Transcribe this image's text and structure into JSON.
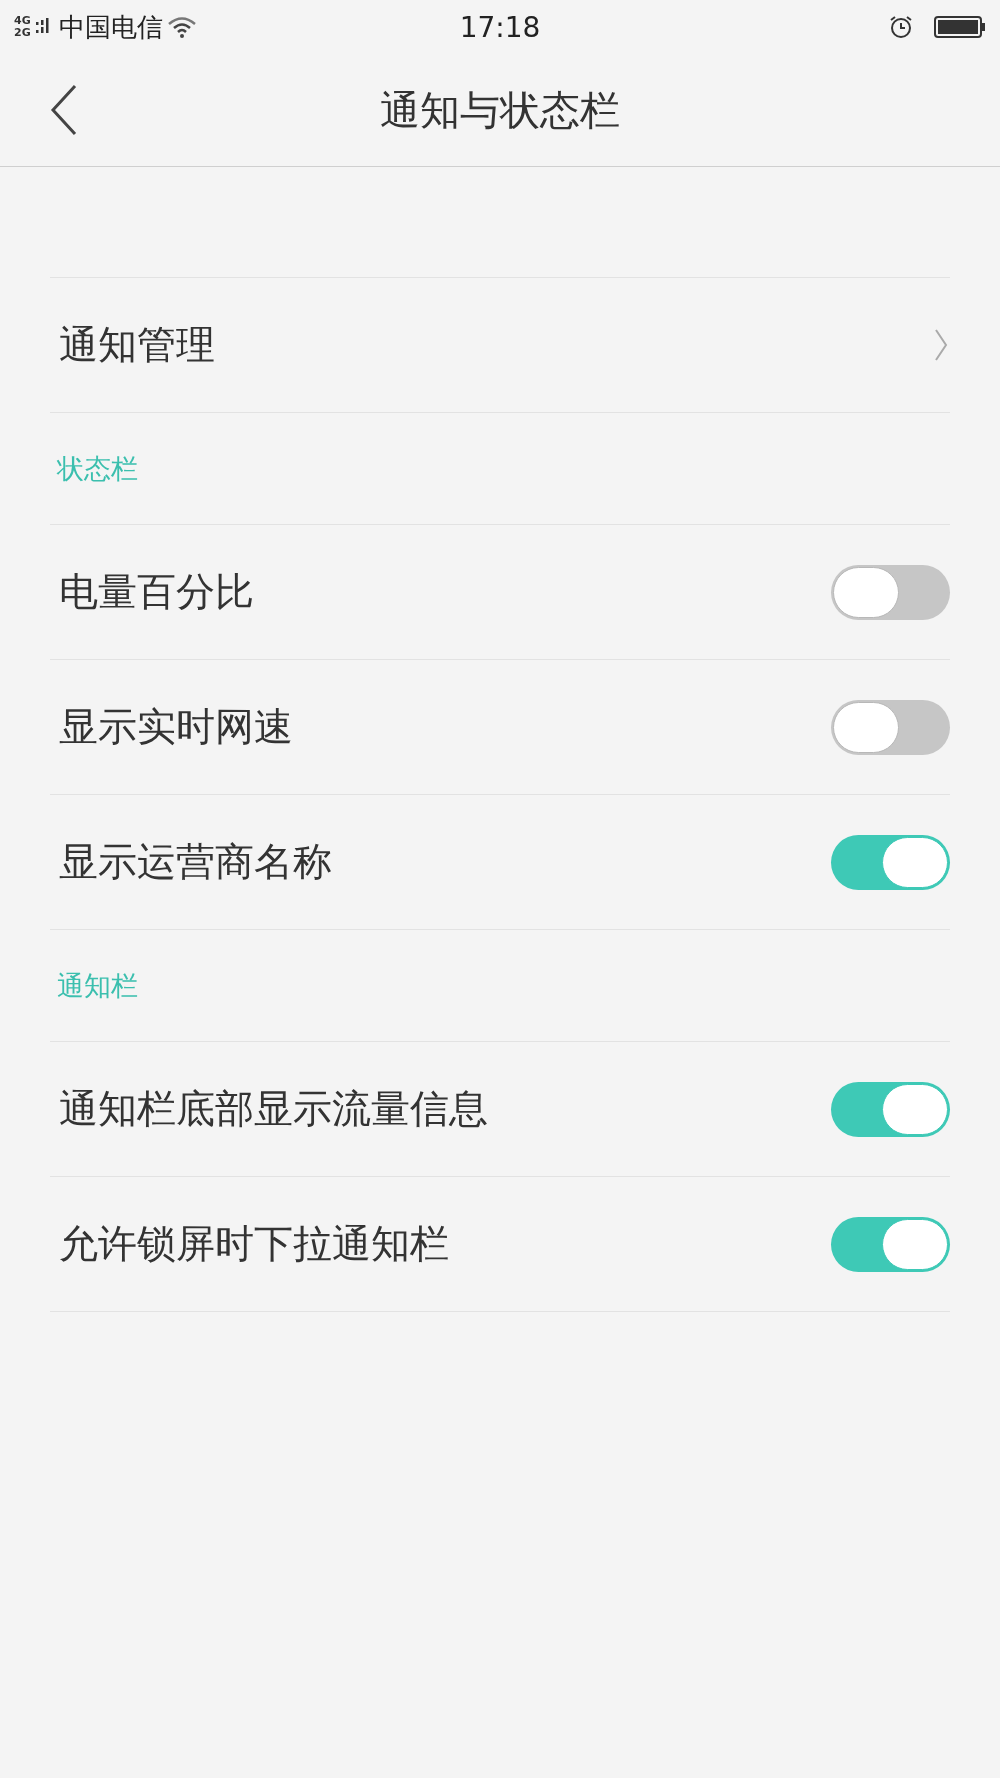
{
  "status_bar": {
    "network_top": "4G",
    "network_bottom": "2G",
    "carrier": "中国电信",
    "time": "17:18"
  },
  "header": {
    "title": "通知与状态栏"
  },
  "items": [
    {
      "kind": "link",
      "label": "通知管理"
    },
    {
      "kind": "section",
      "label": "状态栏"
    },
    {
      "kind": "toggle",
      "label": "电量百分比",
      "on": false
    },
    {
      "kind": "toggle",
      "label": "显示实时网速",
      "on": false
    },
    {
      "kind": "toggle",
      "label": "显示运营商名称",
      "on": true
    },
    {
      "kind": "section",
      "label": "通知栏"
    },
    {
      "kind": "toggle",
      "label": "通知栏底部显示流量信息",
      "on": true
    },
    {
      "kind": "toggle",
      "label": "允许锁屏时下拉通知栏",
      "on": true
    }
  ]
}
